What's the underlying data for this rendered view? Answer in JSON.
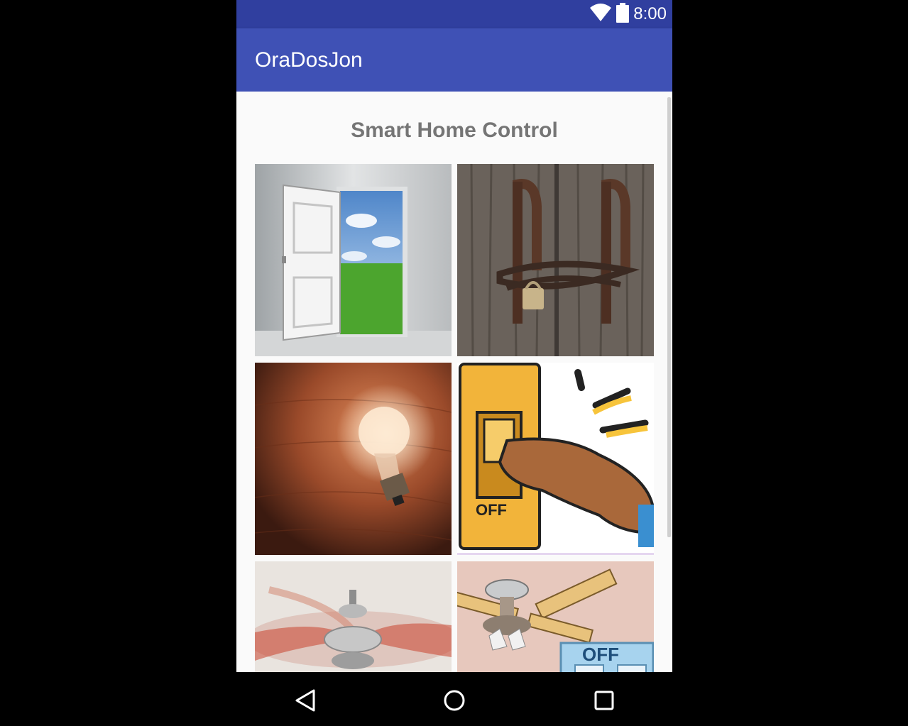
{
  "status_bar": {
    "time": "8:00",
    "icons": [
      "wifi-icon",
      "battery-icon"
    ]
  },
  "app_bar": {
    "title": "OraDosJon"
  },
  "main": {
    "heading": "Smart Home Control",
    "tiles": [
      {
        "name": "open-door-tile",
        "icon": "open-door-image"
      },
      {
        "name": "locked-door-tile",
        "icon": "chained-lock-image"
      },
      {
        "name": "light-on-tile",
        "icon": "light-bulb-image"
      },
      {
        "name": "light-off-tile",
        "icon": "light-switch-off-image",
        "caption": "OFF"
      },
      {
        "name": "fan-on-tile",
        "icon": "spinning-fan-image"
      },
      {
        "name": "fan-off-tile",
        "icon": "ceiling-fan-off-image",
        "caption": "OFF"
      }
    ]
  },
  "nav_bar": {
    "buttons": [
      "back-icon",
      "home-icon",
      "recents-icon"
    ]
  },
  "colors": {
    "status_bar": "#303F9F",
    "app_bar": "#3F51B5",
    "heading": "#757575",
    "background": "#FAFAFA"
  }
}
